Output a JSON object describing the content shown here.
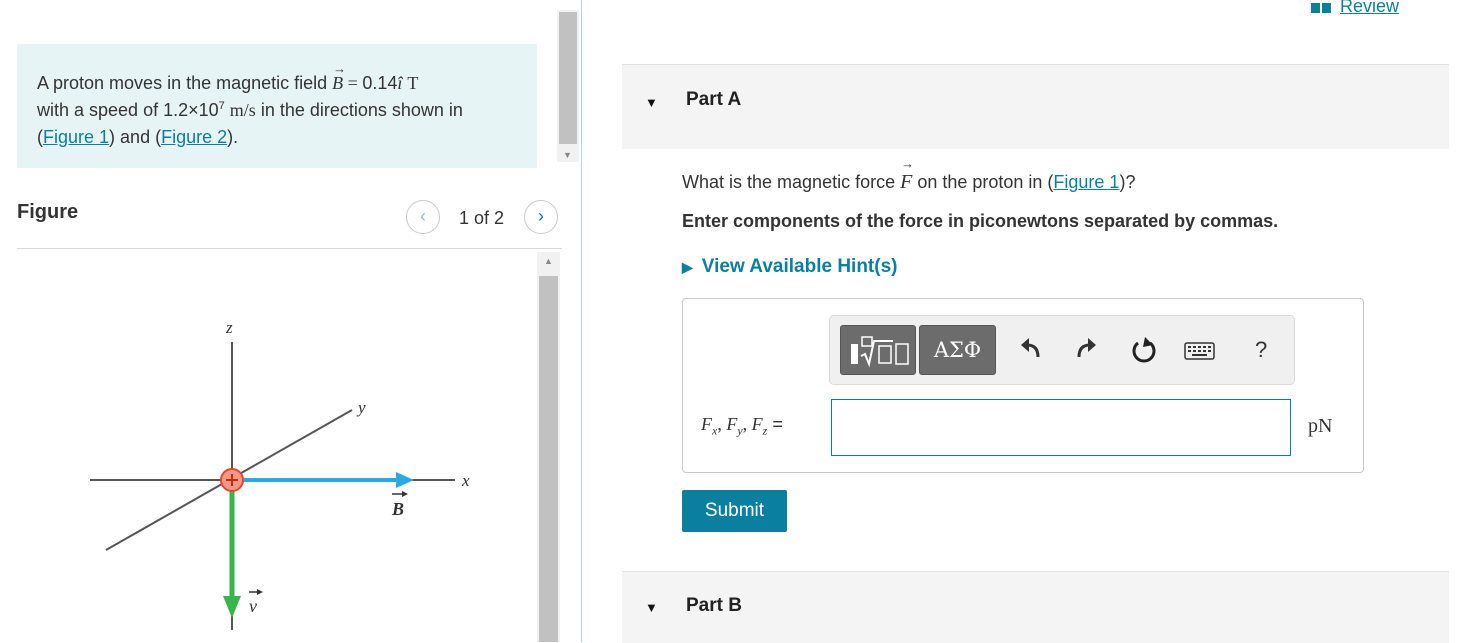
{
  "problem": {
    "text_1": "A proton moves in the magnetic field ",
    "field_symbol": "B",
    "field_equals": " = ",
    "field_value": "0.14",
    "field_unit_vector": "î",
    "field_unit": "T",
    "text_2": "with a speed of ",
    "speed_mantissa": "1.2×10",
    "speed_exponent": "7",
    "speed_unit": "m/s",
    "text_3": " in the directions shown in",
    "open_paren_1": "(",
    "figure_link_1": "Figure 1",
    "mid_text": ") and (",
    "figure_link_2": "Figure 2",
    "close_text": ")."
  },
  "figure": {
    "title": "Figure",
    "counter": "1 of 2",
    "prev_icon": "chevron-left-icon",
    "next_icon": "chevron-right-icon",
    "axis_z": "z",
    "axis_y": "y",
    "axis_x": "x",
    "field_label": "B",
    "velocity_label": "v",
    "colors": {
      "field_arrow": "#29abe2",
      "velocity_arrow": "#39b54a",
      "proton": "#e8452c"
    }
  },
  "header": {
    "review_label": "Review",
    "review_icon": "book-icon"
  },
  "part_a": {
    "label": "Part A",
    "question_pre": "What is the magnetic force ",
    "question_symbol": "F",
    "question_mid": " on the proton in (",
    "question_link": "Figure 1",
    "question_post": ")?",
    "instruction": "Enter components of the force in piconewtons separated by commas.",
    "hints_label": "View Available Hint(s)",
    "toolbar": {
      "greek_label": "ΑΣΦ",
      "icons": [
        "templates-icon",
        "undo-icon",
        "redo-icon",
        "reset-icon",
        "keyboard-icon",
        "help-icon"
      ],
      "help_label": "?"
    },
    "answer_label_f": "F",
    "answer_sub_x": "x",
    "answer_sub_y": "y",
    "answer_sub_z": "z",
    "answer_sep": ", ",
    "answer_equals": " =",
    "answer_value": "",
    "unit": "pN",
    "submit_label": "Submit"
  },
  "part_b": {
    "label": "Part B"
  },
  "colors": {
    "accent": "#0a7fa0",
    "problem_bg": "#e7f4f6",
    "part_header_bg": "#f4f4f4"
  }
}
